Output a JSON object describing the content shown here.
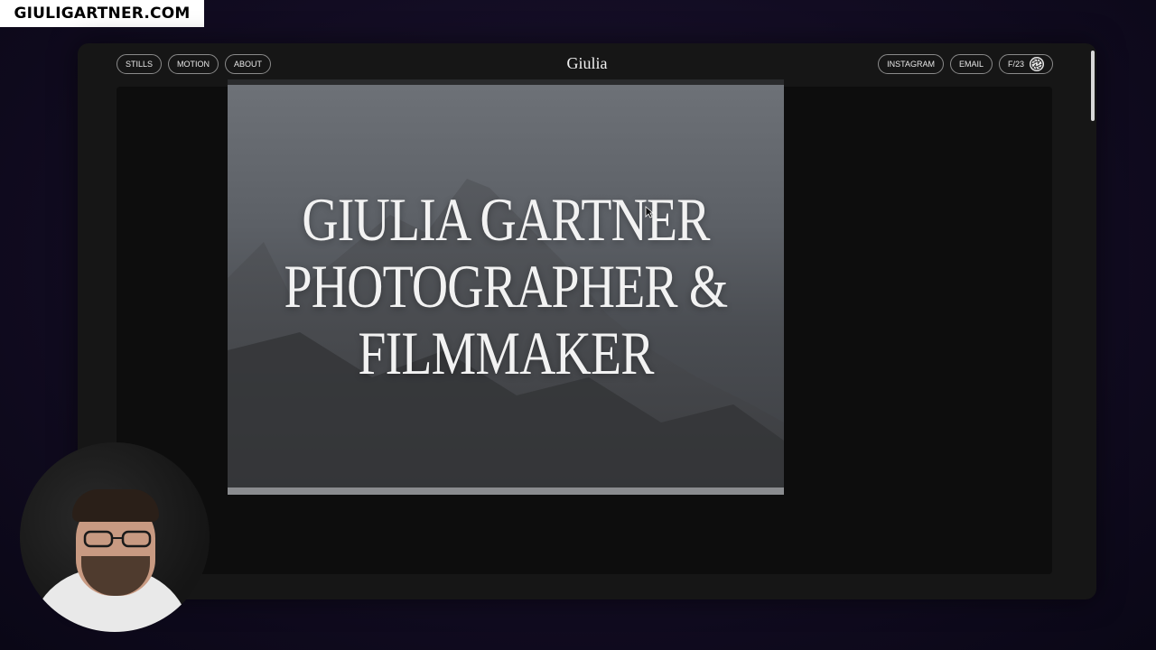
{
  "overlay": {
    "site_tag": "GIULIGARTNER.COM"
  },
  "nav": {
    "left": [
      "STILLS",
      "MOTION",
      "ABOUT"
    ],
    "logo": "Giulia",
    "right": [
      "INSTAGRAM",
      "EMAIL"
    ],
    "frame_counter": "F/23"
  },
  "hero": {
    "line1": "GIULIA GARTNER",
    "line2": "PHOTOGRAPHER &",
    "line3": "FILMMAKER"
  },
  "icons": [
    "aperture-icon",
    "cursor-icon"
  ]
}
